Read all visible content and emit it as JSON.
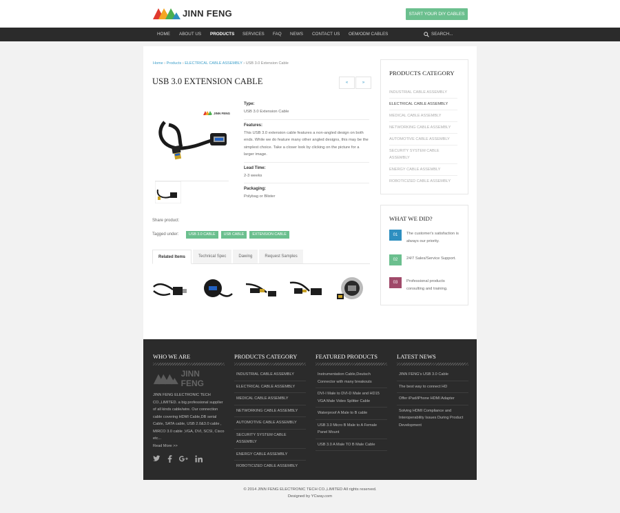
{
  "header": {
    "logo_text": "JINN FENG",
    "cta_label": "START YOUR DIY CABLES",
    "accent_green": "#6bbf8e"
  },
  "nav": {
    "items": [
      "HOME",
      "ABOUT US",
      "PRODUCTS",
      "SERVICES",
      "FAQ",
      "NEWS",
      "CONTACT US",
      "OEM/ODM CABLES"
    ],
    "active": "PRODUCTS",
    "search_label": "SEARCH..."
  },
  "breadcrumb": {
    "home": "Home",
    "products": "Products",
    "category": "ELECTRICAL CABLE ASSEMBLY",
    "current": "USB 3.0 Extension Cable",
    "sep": "›"
  },
  "product": {
    "title": "USB 3.0 EXTENSION CABLE",
    "prev": "«",
    "next": "»",
    "image_logo": "JINN FENG",
    "type_label": "Type:",
    "type_value": "USB 3.0 Extension Cable",
    "features_label": "Features:",
    "features_value": "This USB 3.0 extension cable features a non-angled design on both ends. While we do feature many other angled designs, this may be the simplest choice. Take a closer look by clicking on the picture for a larger image.",
    "lead_label": "Lead Time:",
    "lead_value": "2-3 weeks",
    "packaging_label": "Packaging:",
    "packaging_value": "Polybag or Blister",
    "share_label": "Share product:",
    "tagged_label": "Tagged under:",
    "tags": [
      "USB 3.0 CABLE",
      "USB CABLE",
      "EXTENSION CABLE"
    ]
  },
  "tabs": [
    "Related Items",
    "Technical Spec",
    "Dawing",
    "Request Samples"
  ],
  "sidebar": {
    "category_title": "PRODUCTS CATEGORY",
    "categories": [
      "INDUSTRIAL CABLE ASSEMBLY",
      "ELECTRICAL CABLE ASSEMBLY",
      "MEDICAL CABLE ASSEMBLY",
      "NETWORKING CABLE ASSEMBLY",
      "AUTOMOTIVE CABLE ASSEMBLY",
      "SECURITY SYSTEM CABLE ASSEMBLY",
      "ENERGY CABLE ASSEMBLY",
      "ROBOTICIZED CABLE ASSEMBLY"
    ],
    "whatwedid_title": "WHAT WE DID?",
    "whatwedid": [
      {
        "num": "01",
        "text": "The customer's satisfaction is always our priority.",
        "color": "#2e8fc0"
      },
      {
        "num": "02",
        "text": "24/7 Sales/Service Support.",
        "color": "#6bbf8e"
      },
      {
        "num": "03",
        "text": "Professional products consulting and training.",
        "color": "#a04a6a"
      }
    ]
  },
  "footer": {
    "who_title": "WHO WE ARE",
    "who_text": "JINN FENG ELECTRONIC TECH CO.,LIMITED. a big professional supplier of all kinds cable/wire. Our connection cable covering HDMI Cable,DB serial Cable, SATA cable, USB 2.0&3.0 cable , MIRCO 3.0 cable ,VGA, DVI, SCSI, Cisco etc...",
    "read_more": "Read More >>",
    "products_title": "PRODUCTS CATEGORY",
    "products": [
      "INDUSTRIAL CABLE ASSEMBLY",
      "ELECTRICAL CABLE ASSEMBLY",
      "MEDICAL CABLE ASSEMBLY",
      "NETWORKING CABLE ASSEMBLY",
      "AUTOMOTIVE CABLE ASSEMBLY",
      "SECURITY SYSTEM CABLE ASSEMBLY",
      "ENERGY CABLE ASSEMBLY",
      "ROBOTICIZED CABLE ASSEMBLY"
    ],
    "featured_title": "FEATURED PRODUCTS",
    "featured": [
      "Instrumentation Cable,Deutsch Connector with many breakouts",
      "DVI-I Male to DVI-D Male and HD15 VGA Male Video Splitter Cable",
      "Waterproof A Male to B cable",
      "USB 3.0 Micro B Male to A Female Panel Mount",
      "USB 3.0 A Male TO B Male Cable"
    ],
    "news_title": "LATEST NEWS",
    "news": [
      "JINN FENG's USB 3.0 Cable",
      "The best way to connect HD",
      "Offer iPad/iPhone HDMI Adapter",
      "Solving HDMI Compliance and Interoperability Issues During Product Development"
    ],
    "copyright": "© 2014 JINN FENG ELECTRONIC TECH CO.,LIMITED All rights reserved.",
    "designed": "Designed by YCway.com"
  }
}
